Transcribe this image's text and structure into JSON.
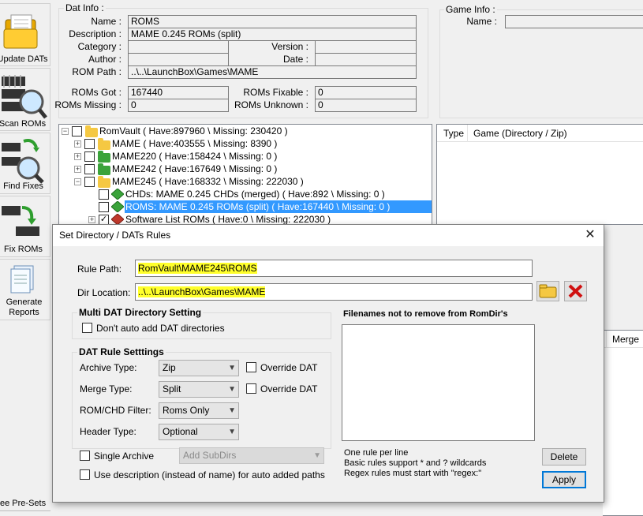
{
  "toolbar": {
    "update_dats": "Update DATs",
    "scan_roms": "Scan ROMs",
    "find_fixes": "Find Fixes",
    "fix_roms": "Fix ROMs",
    "generate_reports": "Generate Reports",
    "tree_presets": "ee Pre-Sets"
  },
  "dat_info": {
    "title": "Dat Info :",
    "name_label": "Name :",
    "name": "ROMS",
    "description_label": "Description :",
    "description": "MAME 0.245 ROMs (split)",
    "category_label": "Category :",
    "category": "",
    "version_label": "Version :",
    "version": "",
    "author_label": "Author :",
    "author": "",
    "date_label": "Date :",
    "date": "",
    "rom_path_label": "ROM Path :",
    "rom_path": "..\\..\\LaunchBox\\Games\\MAME",
    "roms_got_label": "ROMs Got :",
    "roms_got": "167440",
    "roms_fixable_label": "ROMs Fixable :",
    "roms_fixable": "0",
    "roms_missing_label": "ROMs Missing :",
    "roms_missing": "0",
    "roms_unknown_label": "ROMs Unknown :",
    "roms_unknown": "0"
  },
  "game_info": {
    "title": "Game Info :",
    "name_label": "Name :",
    "name": ""
  },
  "tree": {
    "root": "RomVault ( Have:897960 \\ Missing: 230420 )",
    "mame": "MAME ( Have:403555 \\ Missing: 8390 )",
    "mame220": "MAME220 ( Have:158424 \\ Missing: 0 )",
    "mame242": "MAME242 ( Have:167649 \\ Missing: 0 )",
    "mame245": "MAME245 ( Have:168332 \\ Missing: 222030 )",
    "chds": "CHDs: MAME 0.245 CHDs (merged) ( Have:892 \\ Missing: 0 )",
    "roms": "ROMS: MAME 0.245 ROMs (split) ( Have:167440 \\ Missing: 0 )",
    "software": "Software List ROMs ( Have:0 \\ Missing: 222030 )"
  },
  "game_list": {
    "col_type": "Type",
    "col_game": "Game (Directory / Zip)"
  },
  "rom_list": {
    "col_merge": "Merge"
  },
  "dialog": {
    "title": "Set Directory / DATs Rules",
    "rule_path_label": "Rule Path:",
    "rule_path": "RomVault\\MAME245\\ROMS",
    "dir_location_label": "Dir Location:",
    "dir_location": "..\\..\\LaunchBox\\Games\\MAME",
    "multi_dat_title": "Multi DAT Directory Setting",
    "dont_auto_add": "Don't auto add DAT directories",
    "dat_rule_title": "DAT Rule Setttings",
    "archive_type_label": "Archive Type:",
    "archive_type": "Zip",
    "override_dat_1": "Override DAT",
    "merge_type_label": "Merge Type:",
    "merge_type": "Split",
    "override_dat_2": "Override DAT",
    "rom_chd_filter_label": "ROM/CHD Filter:",
    "rom_chd_filter": "Roms Only",
    "header_type_label": "Header Type:",
    "header_type": "Optional",
    "single_archive": "Single Archive",
    "add_subdirs": "Add SubDirs",
    "use_description": "Use description (instead of name) for auto added paths",
    "filenames_title": "Filenames not to remove from RomDir's",
    "hint_1": "One rule per line",
    "hint_2": "Basic rules support * and ? wildcards",
    "hint_3": "Regex rules must start with \"regex:\"",
    "delete_label": "Delete",
    "apply_label": "Apply"
  },
  "colors": {
    "highlight": "#ffff2b",
    "selection": "#3399ff",
    "folder_yellow": "#f5c842",
    "folder_green": "#3aa33a"
  }
}
